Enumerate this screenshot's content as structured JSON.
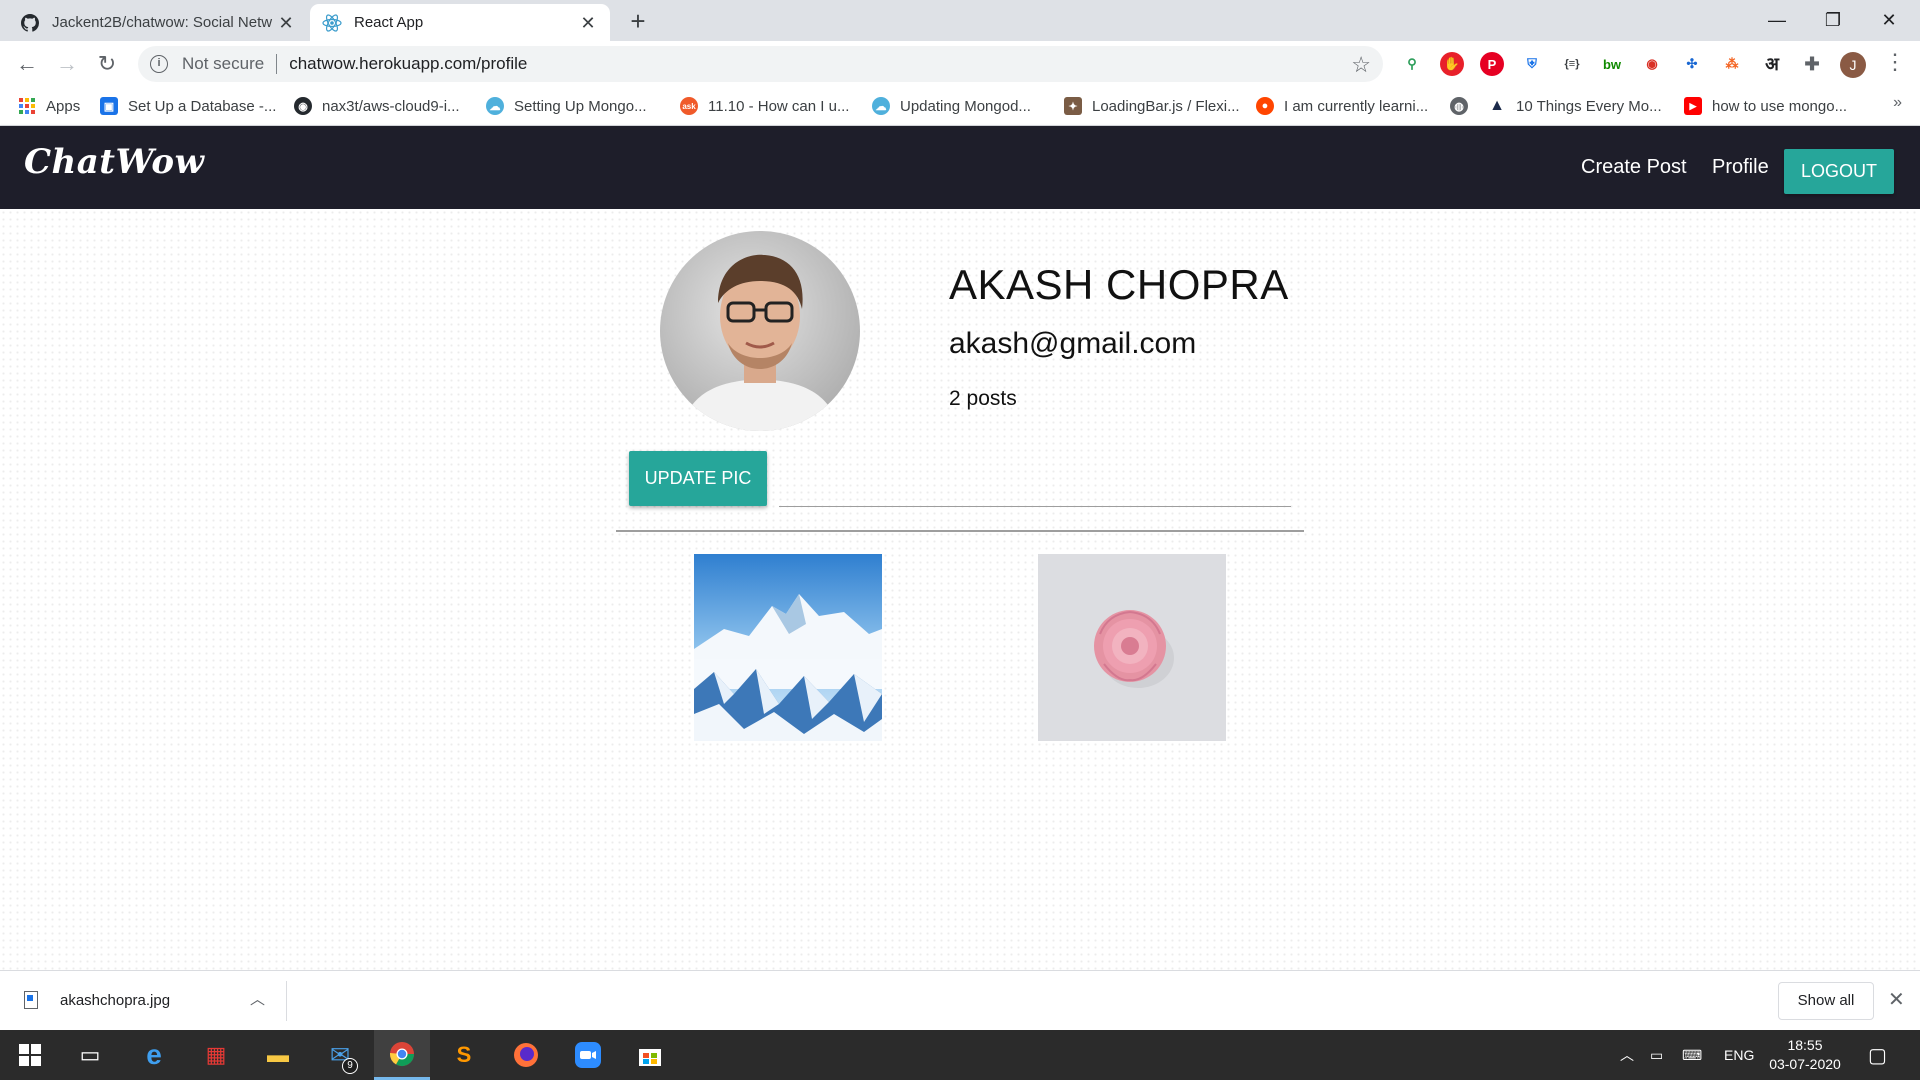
{
  "browser": {
    "tabs": [
      {
        "title": "Jackent2B/chatwow: Social Netw",
        "icon": "github-icon",
        "active": false
      },
      {
        "title": "React App",
        "icon": "react-icon",
        "active": true
      }
    ],
    "omnibox": {
      "security_label": "Not secure",
      "url": "chatwow.herokuapp.com/profile"
    },
    "profile_initial": "J",
    "bookmarks": [
      {
        "label": "Apps",
        "icon": "apps-grid-icon"
      },
      {
        "label": "Set Up a Database -...",
        "icon": "database-icon"
      },
      {
        "label": "nax3t/aws-cloud9-i...",
        "icon": "github-icon"
      },
      {
        "label": "Setting Up Mongo...",
        "icon": "cloud9-icon"
      },
      {
        "label": "11.10 - How can I u...",
        "icon": "ask-icon"
      },
      {
        "label": "Updating Mongod...",
        "icon": "cloud9-icon"
      },
      {
        "label": "LoadingBar.js / Flexi...",
        "icon": "puzzle-icon"
      },
      {
        "label": "I am currently learni...",
        "icon": "reddit-icon"
      },
      {
        "label": "",
        "icon": "globe-icon"
      },
      {
        "label": "10 Things Every Mo...",
        "icon": "arch-icon"
      },
      {
        "label": "how to use mongo...",
        "icon": "youtube-icon"
      }
    ]
  },
  "app": {
    "brand": "ChatWow",
    "nav": {
      "create_post": "Create Post",
      "profile": "Profile",
      "logout": "LOGOUT"
    },
    "profile": {
      "name": "AKASH CHOPRA",
      "email": "akash@gmail.com",
      "posts_label": "2 posts",
      "update_button": "UPDATE PIC",
      "file_path_value": ""
    },
    "posts": [
      {
        "image": "snowy-mountains"
      },
      {
        "image": "pink-rose"
      }
    ],
    "colors": {
      "accent": "#26a69a",
      "navbar": "#1e1e2a"
    }
  },
  "downloads": {
    "filename": "akashchopra.jpg",
    "show_all": "Show all"
  },
  "taskbar": {
    "mail_badge": "9",
    "language": "ENG",
    "time": "18:55",
    "date": "03-07-2020"
  }
}
